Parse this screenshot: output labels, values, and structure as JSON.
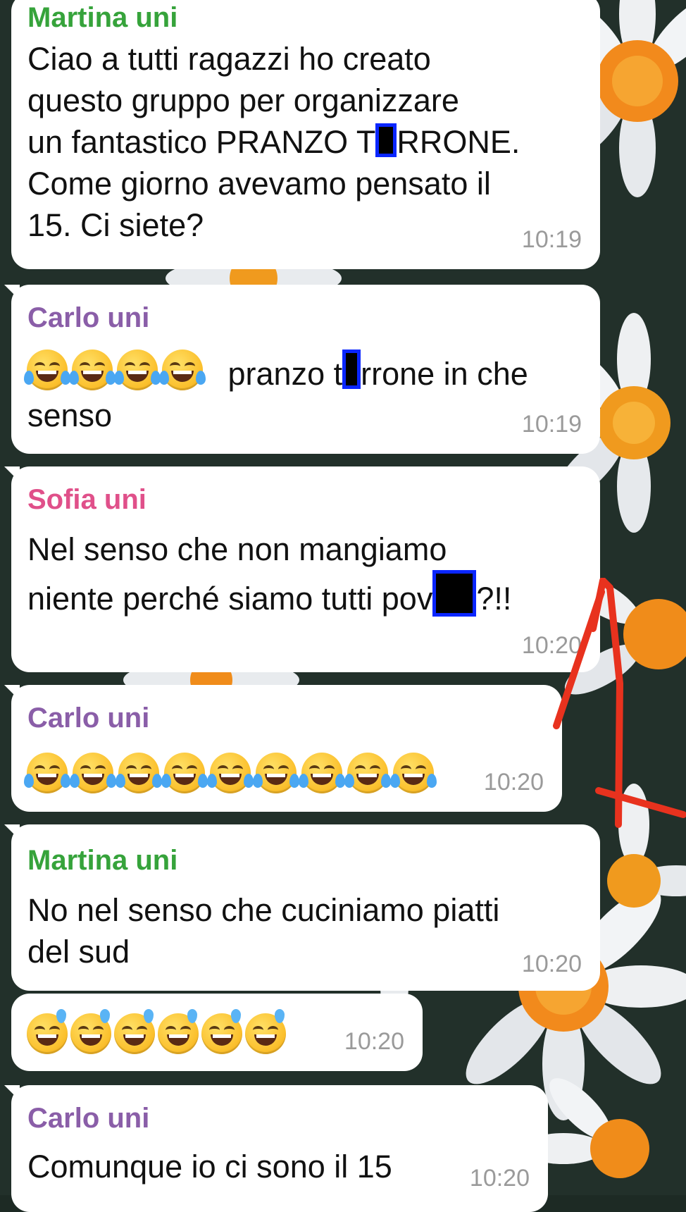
{
  "colors": {
    "bubble_bg": "#ffffff",
    "sender_green": "#36a33b",
    "sender_purple": "#8a5ea8",
    "sender_pink": "#e0508a",
    "time_gray": "#9a9a9a",
    "redact_blue": "#0a26ff",
    "red_annotation": "#e8321e"
  },
  "messages": [
    {
      "sender": "Martina uni",
      "text_part1": "Ciao a tutti ragazzi ho creato\nquesto gruppo per organizzare\nun fantastico PRANZO T",
      "text_part2": "RRONE.\nCome giorno avevamo pensato il\n15. Ci siete?",
      "time": "10:19"
    },
    {
      "sender": "Carlo uni",
      "emoji_icon": "tears-of-joy-emoji",
      "emoji_count": 4,
      "text_part1": " pranzo t",
      "text_part2": "rrone in che\nsenso",
      "time": "10:19"
    },
    {
      "sender": "Sofia uni",
      "text_part1": "Nel senso che non mangiamo\nniente perché siamo tutti pov",
      "text_part2": "?!!",
      "time": "10:20"
    },
    {
      "sender": "Carlo uni",
      "emoji_icon": "tears-of-joy-emoji",
      "emoji_count": 9,
      "time": "10:20"
    },
    {
      "sender": "Martina uni",
      "text": "No nel senso che cuciniamo piatti\ndel sud",
      "time": "10:20"
    },
    {
      "emoji_icon": "grinning-sweat-emoji",
      "emoji_count": 6,
      "time": "10:20"
    },
    {
      "sender": "Carlo uni",
      "text": "Comunque io ci sono il 15",
      "time": "10:20"
    }
  ]
}
